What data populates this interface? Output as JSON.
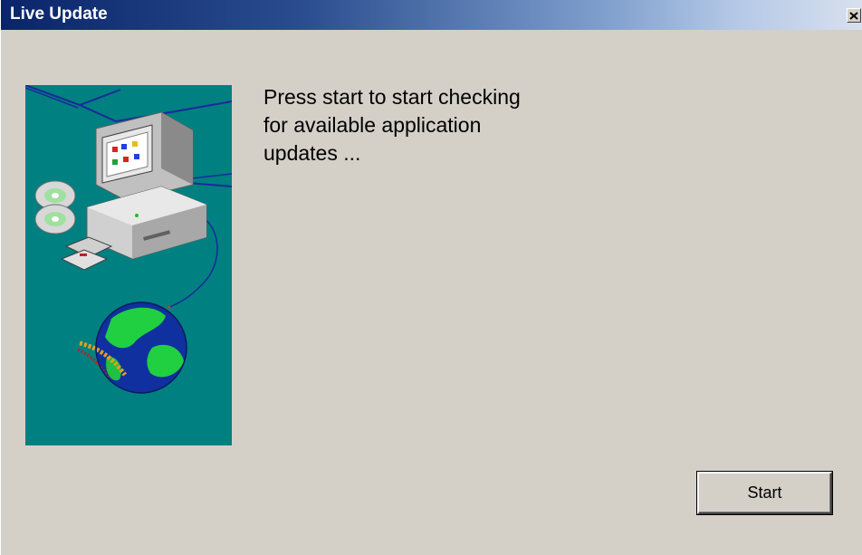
{
  "window": {
    "title": "Live Update",
    "close_icon": "close-icon"
  },
  "illustration": {
    "icon": "computer-globe-illustration",
    "background_color": "#008080"
  },
  "message": {
    "lines": [
      "Press start to start checking",
      "for available application",
      "updates ..."
    ]
  },
  "buttons": {
    "start_label": "Start"
  },
  "colors": {
    "titlebar_start": "#0a246a",
    "dialog_face": "#d4d0c8"
  }
}
